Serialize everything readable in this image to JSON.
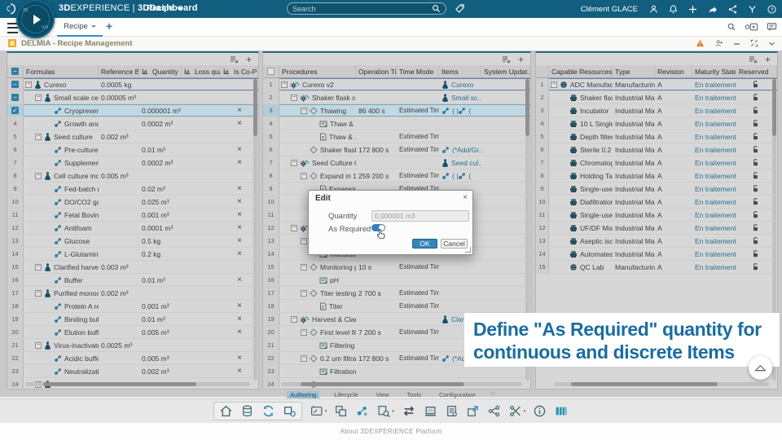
{
  "topbar": {
    "brand_bold": "3D",
    "brand_rest": "EXPERIENCE",
    "separator": "|",
    "app": "3DDashboard",
    "context": "Recipe",
    "search_placeholder": "Search",
    "user": "Clément GLACE"
  },
  "tabbar": {
    "tab": "Recipe"
  },
  "app_header": {
    "title": "DELMIA - Recipe Management"
  },
  "dialog": {
    "title": "Edit",
    "quantity_label": "Quantity",
    "quantity_value": "0,000001 m3",
    "as_required_label": "As Required",
    "as_required_on": true,
    "ok": "OK",
    "cancel": "Cancel",
    "close": "×"
  },
  "caption": {
    "line1": "Define \"As Required\" quantity for",
    "line2": "continuous and discrete Items"
  },
  "bottom": {
    "tabs": [
      "Authoring",
      "Lifecycle",
      "View",
      "Tools",
      "Configuration"
    ],
    "active_tab": "Authoring",
    "about": "About 3DEXPERIENCE Platform"
  },
  "colors": {
    "topbar": "#115e7e",
    "accent": "#3c8dbf",
    "link": "#26708f",
    "selected_row": "#c2d8e1",
    "ok_button": "#3286b8",
    "warning": "#e87b1e",
    "caption_text": "#1a6da0"
  },
  "panels": {
    "formulas": {
      "columns": [
        "Formulas",
        "Reference Bat...",
        "Quantity",
        "Loss quan...",
        "Is Co-Pro..."
      ],
      "rows": [
        {
          "n": 1,
          "head": "ind",
          "lvl": 0,
          "exp": true,
          "icon": "formula",
          "name": "Curexo",
          "ref": "0.0005 kg",
          "root": true
        },
        {
          "n": 2,
          "head": "ind",
          "lvl": 1,
          "exp": true,
          "icon": "formula",
          "name": "Small scale cell ...",
          "ref": "0.00005 m³"
        },
        {
          "n": 3,
          "head": "chk",
          "lvl": 2,
          "icon": "material",
          "name": "Cryopreserv...",
          "qty": "0.000001 m³",
          "x": true,
          "sel": true
        },
        {
          "n": 4,
          "lvl": 2,
          "icon": "material",
          "name": "Growth and ...",
          "qty": "0.0002 m³",
          "x": true
        },
        {
          "n": 5,
          "lvl": 1,
          "exp": true,
          "icon": "formula",
          "name": "Seed culture",
          "ref": "0.002 m³"
        },
        {
          "n": 6,
          "lvl": 2,
          "icon": "material",
          "name": "Pre-culture ...",
          "qty": "0.01 m³",
          "x": true
        },
        {
          "n": 7,
          "lvl": 2,
          "icon": "material",
          "name": "Supplements",
          "qty": "0.0002 m³",
          "x": true
        },
        {
          "n": 8,
          "lvl": 1,
          "exp": true,
          "icon": "formula",
          "name": "Cell culture inoc...",
          "ref": "0.005 m³"
        },
        {
          "n": 9,
          "lvl": 2,
          "icon": "material",
          "name": "Fed-batch m...",
          "qty": "0.02 m³",
          "x": true
        },
        {
          "n": 10,
          "lvl": 2,
          "icon": "material",
          "name": "DO/CO2 ga...",
          "qty": "0.025 m³",
          "x": true
        },
        {
          "n": 11,
          "lvl": 2,
          "icon": "material",
          "name": "Fetal Bovine...",
          "qty": "0.001 m³",
          "x": true
        },
        {
          "n": 12,
          "lvl": 2,
          "icon": "material",
          "name": "Antifoam",
          "qty": "0.0001 m³",
          "x": true
        },
        {
          "n": 13,
          "lvl": 2,
          "icon": "material",
          "name": "Glucose",
          "qty": "0.5 kg",
          "x": true
        },
        {
          "n": 14,
          "lvl": 2,
          "icon": "material",
          "name": "L-Glutamine",
          "qty": "0.2 kg",
          "x": true
        },
        {
          "n": 15,
          "lvl": 1,
          "exp": true,
          "icon": "formula",
          "name": "Clarified harvest",
          "ref": "0.003 m³"
        },
        {
          "n": 16,
          "lvl": 2,
          "icon": "material",
          "name": "Buffer",
          "qty": "0.01 m³",
          "x": true
        },
        {
          "n": 17,
          "lvl": 1,
          "exp": true,
          "icon": "formula",
          "name": "Purified monoclo...",
          "ref": "0.002 m³"
        },
        {
          "n": 18,
          "lvl": 2,
          "icon": "material",
          "name": "Protein A resin",
          "qty": "0.001 m³",
          "x": true
        },
        {
          "n": 19,
          "lvl": 2,
          "icon": "material",
          "name": "Binding buffer",
          "qty": "0.01 m³",
          "x": true
        },
        {
          "n": 20,
          "lvl": 2,
          "icon": "material",
          "name": "Elution buffer",
          "qty": "0.005 m³",
          "x": true
        },
        {
          "n": 21,
          "lvl": 1,
          "exp": true,
          "icon": "formula",
          "name": "Virus-inactivated...",
          "ref": "0.0025 m³"
        },
        {
          "n": 22,
          "lvl": 2,
          "icon": "material",
          "name": "Acidic buffer...",
          "qty": "0.005 m³",
          "x": true
        },
        {
          "n": 23,
          "lvl": 2,
          "icon": "material",
          "name": "Neutralizatio...",
          "qty": "0.002 m³",
          "x": true
        },
        {
          "n": 24,
          "lvl": 1,
          "exp": true,
          "icon": "formula",
          "name": ""
        }
      ]
    },
    "procedures": {
      "columns": [
        "Procedures",
        "Operation Time",
        "Time Mode",
        "Items",
        "System Updat..."
      ],
      "rows": [
        {
          "n": 1,
          "lvl": 0,
          "exp": true,
          "icon": "proc",
          "name": "Curexo v2",
          "items": [
            {
              "icon": "formula",
              "t": "Curexo"
            }
          ],
          "root": true
        },
        {
          "n": 2,
          "lvl": 1,
          "exp": true,
          "icon": "proc",
          "name": "Shaker flask cell...",
          "items": [
            {
              "icon": "formula",
              "t": "Small sc..."
            }
          ]
        },
        {
          "n": 3,
          "lvl": 2,
          "exp": true,
          "icon": "op",
          "name": "Thawing",
          "op": "86 400 s",
          "mode": "Estimated Time",
          "items": [
            {
              "icon": "material",
              "t": "( |"
            },
            {
              "icon": "material",
              "t": "("
            }
          ],
          "sel": true
        },
        {
          "n": 4,
          "lvl": 3,
          "icon": "instr",
          "name": "Thaw & ..."
        },
        {
          "n": 5,
          "lvl": 3,
          "icon": "doc",
          "name": "Thaw & ...",
          "mode": "Estimated Time"
        },
        {
          "n": 6,
          "lvl": 2,
          "icon": "op",
          "name": "Shaker flask...",
          "op": "172 800 s",
          "mode": "Estimated Time",
          "items": [
            {
              "icon": "material",
              "t": "(*Add/Gr..."
            }
          ]
        },
        {
          "n": 7,
          "lvl": 1,
          "exp": true,
          "icon": "proc",
          "name": "Seed Culture Gr...",
          "items": [
            {
              "icon": "formula",
              "t": "Seed cul..."
            }
          ]
        },
        {
          "n": 8,
          "lvl": 2,
          "exp": true,
          "icon": "op",
          "name": "Expand in 1...",
          "op": "259 200 s",
          "mode": "Estimated Time",
          "items": [
            {
              "icon": "material",
              "t": "( |"
            },
            {
              "icon": "material",
              "t": "("
            }
          ]
        },
        {
          "n": 9,
          "lvl": 3,
          "icon": "doc",
          "name": "Expansio...",
          "mode": "Estimated Time"
        },
        {
          "n": 10,
          "lvl": 3,
          "icon": "",
          "name": ""
        },
        {
          "n": 11,
          "lvl": 3,
          "icon": "",
          "name": ""
        },
        {
          "n": 12,
          "lvl": 1,
          "exp": true,
          "icon": "proc",
          "name": ""
        },
        {
          "n": 13,
          "lvl": 2,
          "exp": true,
          "icon": "op",
          "name": ""
        },
        {
          "n": 14,
          "lvl": 3,
          "icon": "instr",
          "name": "Inoculati..."
        },
        {
          "n": 15,
          "lvl": 2,
          "exp": true,
          "icon": "op",
          "name": "Monitoring pH",
          "op": "10 s",
          "mode": "Estimated Time"
        },
        {
          "n": 16,
          "lvl": 3,
          "icon": "instr",
          "name": "pH"
        },
        {
          "n": 17,
          "lvl": 2,
          "exp": true,
          "icon": "op",
          "name": "Titer testing",
          "op": "2 700 s",
          "mode": "Estimated Time"
        },
        {
          "n": 18,
          "lvl": 3,
          "icon": "doc",
          "name": "Titer",
          "mode": "Estimated Time"
        },
        {
          "n": 19,
          "lvl": 1,
          "exp": true,
          "icon": "proc",
          "name": "Harvest & Clarifi...",
          "items": [
            {
              "icon": "formula",
              "t": "Clarifi..."
            }
          ]
        },
        {
          "n": 20,
          "lvl": 2,
          "exp": true,
          "icon": "op",
          "name": "First level filt...",
          "op": "7 200 s",
          "mode": "Estimated Time"
        },
        {
          "n": 21,
          "lvl": 3,
          "icon": "instr",
          "name": "Filtering"
        },
        {
          "n": 22,
          "lvl": 2,
          "exp": true,
          "icon": "op",
          "name": "0.2 um filtrati...",
          "op": "172 800 s",
          "mode": "Estimated Time",
          "items": [
            {
              "icon": "material",
              "t": "(*Add..."
            }
          ]
        },
        {
          "n": 23,
          "lvl": 3,
          "icon": "instr",
          "name": "Filtration"
        },
        {
          "n": 24,
          "lvl": 2,
          "icon": "op",
          "name": ""
        }
      ]
    },
    "resources": {
      "columns": [
        "Capable Resources",
        "Type",
        "Revision",
        "Maturity State",
        "Reserved"
      ],
      "rows": [
        {
          "n": 1,
          "lvl": 0,
          "exp": true,
          "icon": "org",
          "name": "ADC Manufacturing ...",
          "type": "Manufacturing...",
          "rev": "A",
          "mat": "En traitement",
          "lock": true,
          "root": true
        },
        {
          "n": 2,
          "lvl": 1,
          "icon": "machine",
          "name": "Shaker flask",
          "type": "Industrial Mac...",
          "rev": "A",
          "mat": "En traitement",
          "lock": true
        },
        {
          "n": 3,
          "lvl": 1,
          "icon": "machine",
          "name": "Incubator",
          "type": "Industrial Mac...",
          "rev": "A",
          "mat": "En traitement",
          "lock": true
        },
        {
          "n": 4,
          "lvl": 1,
          "icon": "machine",
          "name": "10 L Single Use ...",
          "type": "Industrial Mac...",
          "rev": "A",
          "mat": "En traitement",
          "lock": true
        },
        {
          "n": 5,
          "lvl": 1,
          "icon": "machine",
          "name": "Depth filters",
          "type": "Industrial Mac...",
          "rev": "A",
          "mat": "En traitement",
          "lock": true
        },
        {
          "n": 6,
          "lvl": 1,
          "icon": "machine",
          "name": "Sterile 0.2 um filt...",
          "type": "Industrial Mac...",
          "rev": "A",
          "mat": "En traitement",
          "lock": true
        },
        {
          "n": 7,
          "lvl": 1,
          "icon": "machine",
          "name": "Chromatography...",
          "type": "Industrial Mac...",
          "rev": "A",
          "mat": "En traitement",
          "lock": true
        },
        {
          "n": 8,
          "lvl": 1,
          "icon": "machine",
          "name": "Holding Tank",
          "type": "Industrial Mac...",
          "rev": "A",
          "mat": "En traitement",
          "lock": true
        },
        {
          "n": 9,
          "lvl": 1,
          "icon": "machine",
          "name": "Single-use jacke...",
          "type": "Industrial Mac...",
          "rev": "A",
          "mat": "En traitement",
          "lock": true
        },
        {
          "n": 10,
          "lvl": 1,
          "icon": "machine",
          "name": "Diafiltration skid",
          "type": "Industrial Mac...",
          "rev": "A",
          "mat": "En traitement",
          "lock": true
        },
        {
          "n": 11,
          "lvl": 1,
          "icon": "machine",
          "name": "Single-use chro...",
          "type": "Industrial Mac...",
          "rev": "A",
          "mat": "En traitement",
          "lock": true
        },
        {
          "n": 12,
          "lvl": 1,
          "icon": "machine",
          "name": "UF/DF Mixing skid",
          "type": "Industrial Mac...",
          "rev": "A",
          "mat": "En traitement",
          "lock": true
        },
        {
          "n": 13,
          "lvl": 1,
          "icon": "machine",
          "name": "Aseptic isolator",
          "type": "Industrial Mac...",
          "rev": "A",
          "mat": "En traitement",
          "lock": true
        },
        {
          "n": 14,
          "lvl": 1,
          "icon": "machine",
          "name": "Automated Fill &...",
          "type": "Industrial Mac...",
          "rev": "A",
          "mat": "En traitement",
          "lock": true
        },
        {
          "n": 15,
          "lvl": 1,
          "icon": "org",
          "name": "QC Lab",
          "type": "Manufacturing...",
          "rev": "A",
          "mat": "En traitement",
          "lock": true
        }
      ]
    }
  }
}
